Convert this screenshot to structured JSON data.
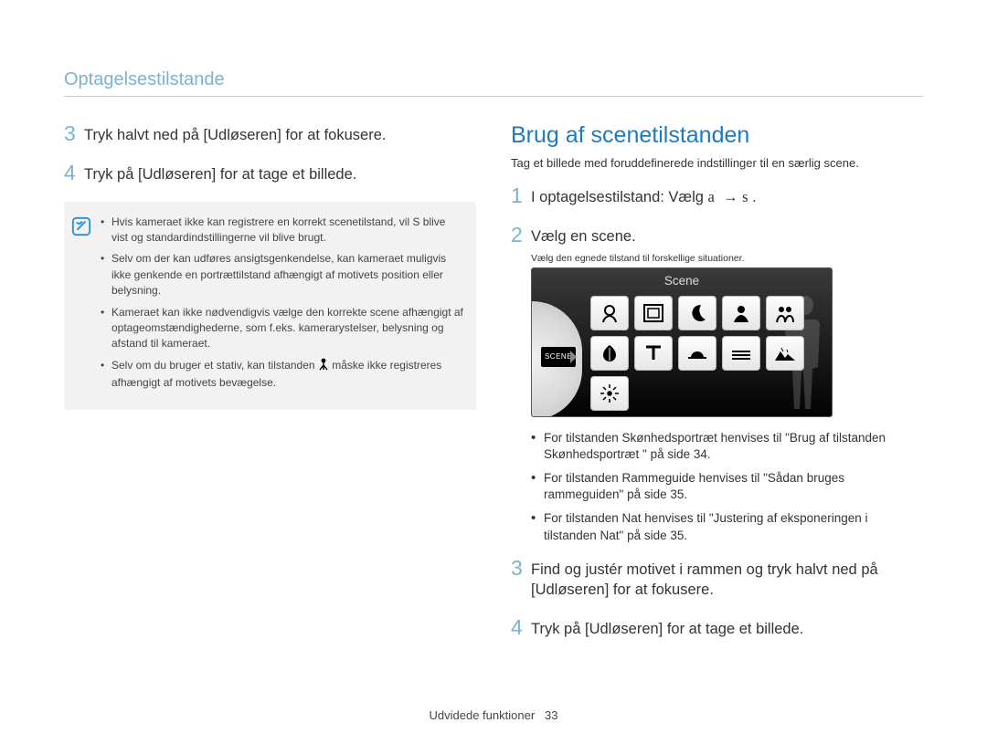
{
  "header": {
    "title": "Optagelsestilstande"
  },
  "left": {
    "step3": "Tryk halvt ned på [Udløseren] for at fokusere.",
    "step4": "Tryk på [Udløseren] for at tage et billede.",
    "notes": {
      "n1": "Hvis kameraet ikke kan registrere en korrekt scenetilstand, vil S blive vist og standardindstillingerne vil blive brugt.",
      "n2": "Selv om der kan udføres ansigtsgenkendelse, kan kameraet muligvis ikke genkende en portrættilstand afhængigt af motivets position eller belysning.",
      "n3": "Kameraet kan ikke nødvendigvis vælge den korrekte scene afhængigt af optageomstændighederne, som f.eks. kamerarystelser, belysning og afstand til kameraet.",
      "n4a": "Selv om du bruger et stativ, kan tilstanden ",
      "n4b": " måske ikke registreres afhængigt af motivets bevægelse."
    }
  },
  "right": {
    "title": "Brug af scenetilstanden",
    "desc": "Tag et billede med foruddefinerede indstillinger til en særlig scene.",
    "step1": "I optagelsestilstand: Vælg a  → s  .",
    "step2": "Vælg en scene.",
    "screen_note": "Vælg den egnede tilstand til forskellige situationer.",
    "scene_label": "Scene",
    "scene_badge": "SCENE",
    "bullets": {
      "b1": "For tilstanden Skønhedsportræt henvises til \"Brug af tilstanden Skønhedsportræt \" på side 34.",
      "b2": "For tilstanden Rammeguide henvises til \"Sådan bruges rammeguiden\" på side 35.",
      "b3": "For tilstanden Nat henvises til \"Justering af eksponeringen i tilstanden Nat\" på side 35."
    },
    "step3": "Find og justér motivet i rammen og tryk halvt ned på [Udløseren] for at fokusere.",
    "step4": "Tryk på [Udløseren] for at tage et billede."
  },
  "footer": {
    "section": "Udvidede funktioner",
    "page": "33"
  }
}
